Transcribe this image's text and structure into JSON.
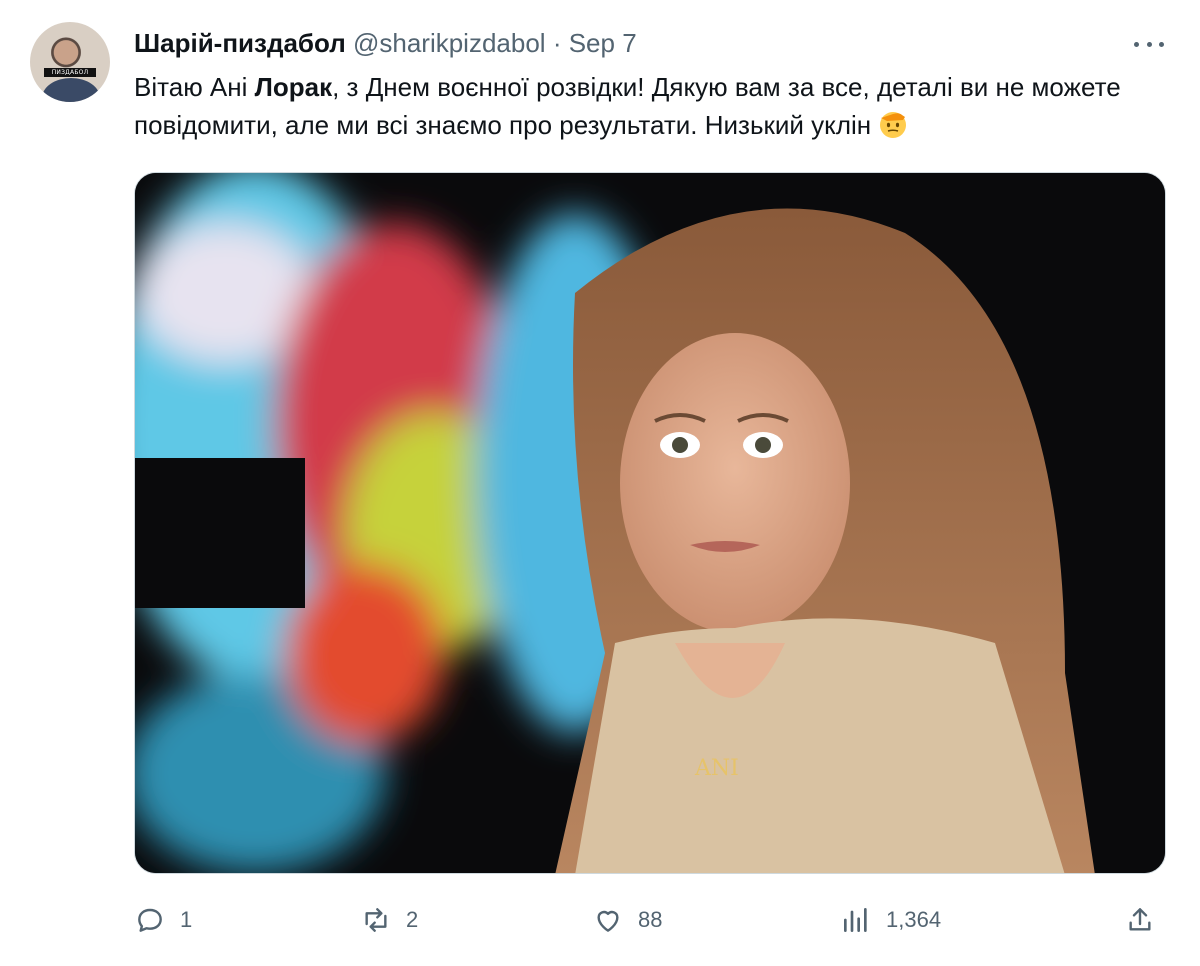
{
  "tweet": {
    "display_name": "Шарій-пиздабол",
    "handle": "@sharikpizdabol",
    "separator": "·",
    "date": "Sep 7",
    "avatar_label": "ПИЗДАБОЛ",
    "text_part1": "Вітаю Ані ",
    "text_bold": "Лорак",
    "text_part2": ", з Днем воєнної розвідки! Дякую вам за все, деталі ви не можете повідомити, але ми всі знаємо про результати. Низький уклін",
    "emoji": "saluting-face-emoji",
    "media_necklace_text": "ANI"
  },
  "actions": {
    "replies": "1",
    "retweets": "2",
    "likes": "88",
    "views": "1,364"
  },
  "colors": {
    "text": "#0f1419",
    "secondary": "#536471",
    "border": "#cfd9de"
  }
}
